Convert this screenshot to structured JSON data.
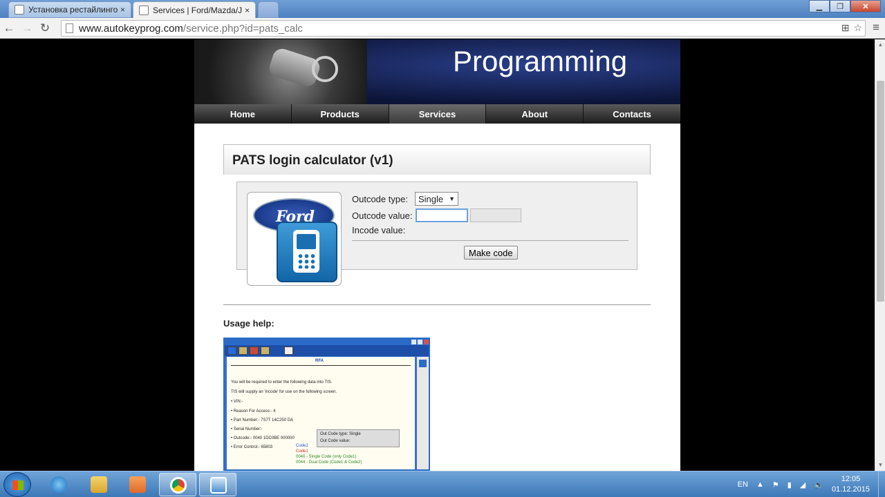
{
  "browser": {
    "tabs": [
      {
        "label": "Установка рестайлинговой",
        "close": "×"
      },
      {
        "label": "Services | Ford/Mazda/Jag",
        "close": "×"
      }
    ],
    "url_host": "www.autokeyprog.com",
    "url_rest": "/service.php?id=pats_calc",
    "window_buttons": {
      "minimize": "▁",
      "maximize": "❐",
      "close": "✕"
    }
  },
  "site": {
    "banner_title": "Programming",
    "nav": [
      "Home",
      "Products",
      "Services",
      "About",
      "Contacts"
    ],
    "active_nav": "Services"
  },
  "calculator": {
    "title": "PATS login calculator (v1)",
    "ford_logo_text": "Ford",
    "outcode_type_label": "Outcode type:",
    "outcode_type_value": "Single",
    "outcode_value_label": "Outcode value:",
    "outcode_value": "",
    "incode_value_label": "Incode value:",
    "make_code_button": "Make code"
  },
  "usage": {
    "heading": "Usage help:",
    "screenshot": {
      "header": "RFA",
      "line1": "You will be required to enter the following data into TIS.",
      "line2": "TIS will supply an 'incode' for use on the following screen.",
      "vin": "• VIN:-",
      "reason": "• Reason For Access:-  4",
      "part": "• Part Number:-     7S7T 14C250 DA",
      "serial": "• Serial Number:-",
      "outcode": "• Outcode:-   0040  1DC0BE  000000",
      "error": "• Error Control:-   65803",
      "mini_type": "Out Code type:  Single",
      "mini_value": "Out Code value:",
      "code2": "Code2",
      "code1": "Code1",
      "note1": "0040 - Single Code (only Code1)",
      "note2": "0044 - Dual Code (Code1 & Code2)"
    }
  },
  "taskbar": {
    "lang": "EN",
    "time": "12:05",
    "date": "01.12.2015"
  },
  "colors": {
    "nav_bg": "#1d1d1d",
    "banner": "#0c1438",
    "taskbar": "#3d78b8"
  }
}
